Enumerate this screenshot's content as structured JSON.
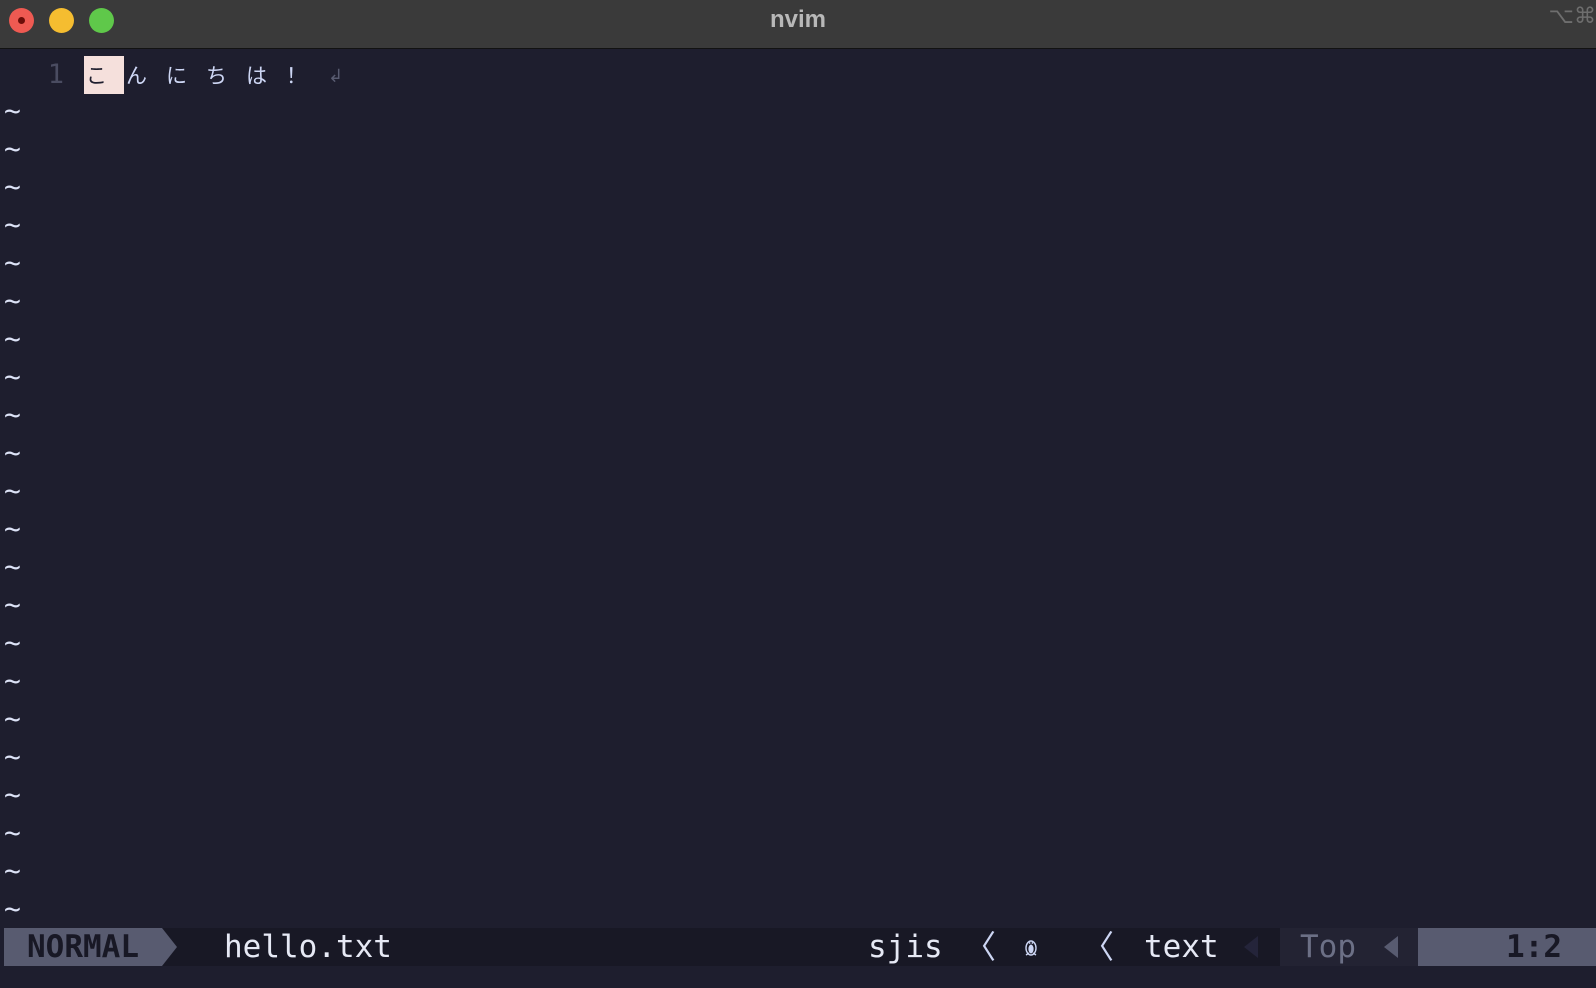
{
  "window": {
    "title": "nvim",
    "shortcut_hint": "⌥⌘"
  },
  "editor": {
    "line_number": "1",
    "chars": [
      "こ",
      "ん",
      "に",
      "ち",
      "は",
      "！"
    ],
    "cursor_index": 0,
    "eol_marker": "↲",
    "empty_line_marker": "~",
    "empty_line_count": 22
  },
  "statusline": {
    "mode": "NORMAL",
    "filename": "hello.txt",
    "encoding": "sjis",
    "separator": "〈",
    "os_icon": "penguin-icon",
    "filetype": "text",
    "position": "Top",
    "line_col": "1:2"
  },
  "colors": {
    "background": "#1e1e2e",
    "cursor": "#f5e0dc",
    "mode_bg": "#585b70",
    "titlebar": "#3a3a3a"
  }
}
